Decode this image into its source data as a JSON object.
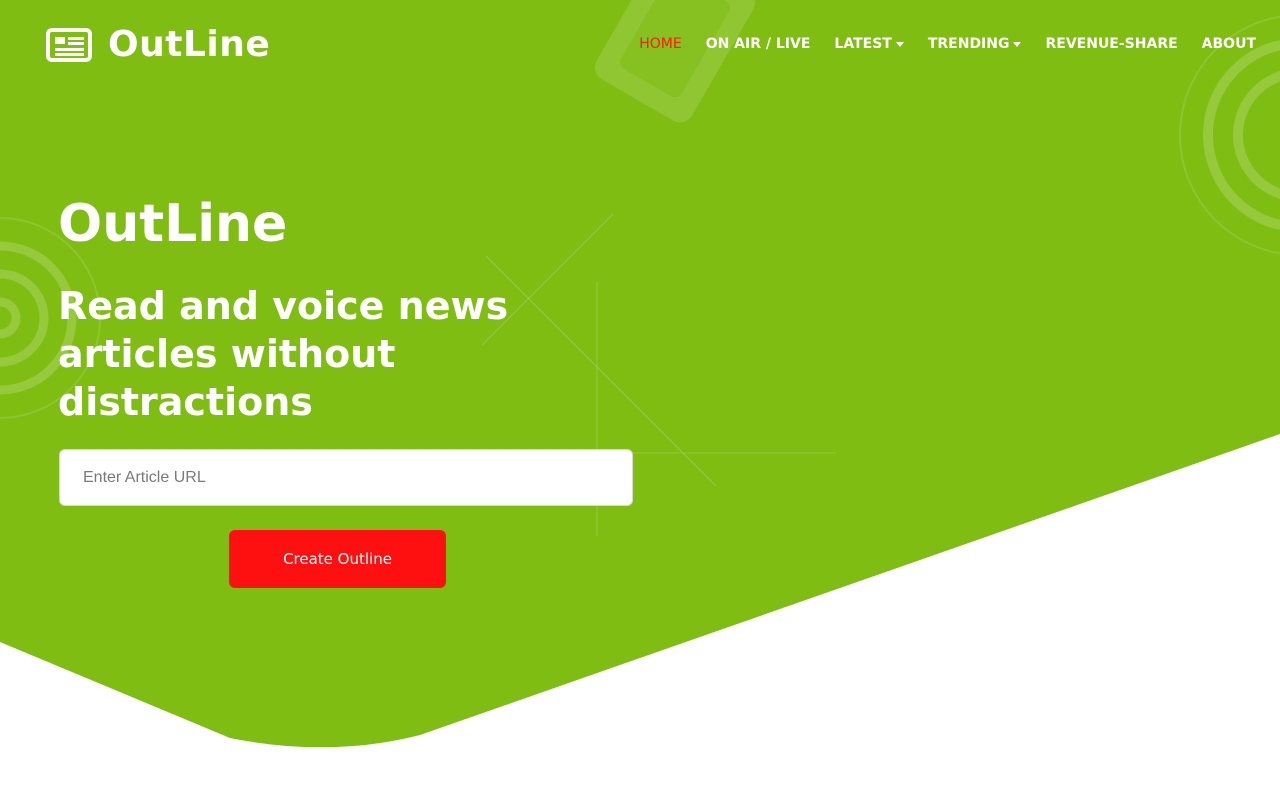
{
  "brand": {
    "name": "OutLine",
    "icon": "newspaper-icon"
  },
  "nav": {
    "items": [
      {
        "label": "HOME",
        "active": true,
        "dropdown": false
      },
      {
        "label": "ON AIR / LIVE",
        "active": false,
        "dropdown": false
      },
      {
        "label": "LATEST",
        "active": false,
        "dropdown": true
      },
      {
        "label": "TRENDING",
        "active": false,
        "dropdown": true
      },
      {
        "label": "REVENUE-SHARE",
        "active": false,
        "dropdown": false
      },
      {
        "label": "ABOUT",
        "active": false,
        "dropdown": false
      }
    ]
  },
  "hero": {
    "title": "OutLine",
    "subtitle": "Read and voice news articles without distractions",
    "url_input": {
      "value": "",
      "placeholder": "Enter Article URL"
    },
    "create_button_label": "Create Outline"
  },
  "colors": {
    "hero_green": "#7fbd12",
    "accent_red": "#ff1010",
    "active_nav": "#ff1a00",
    "text_white": "#ffffff"
  }
}
